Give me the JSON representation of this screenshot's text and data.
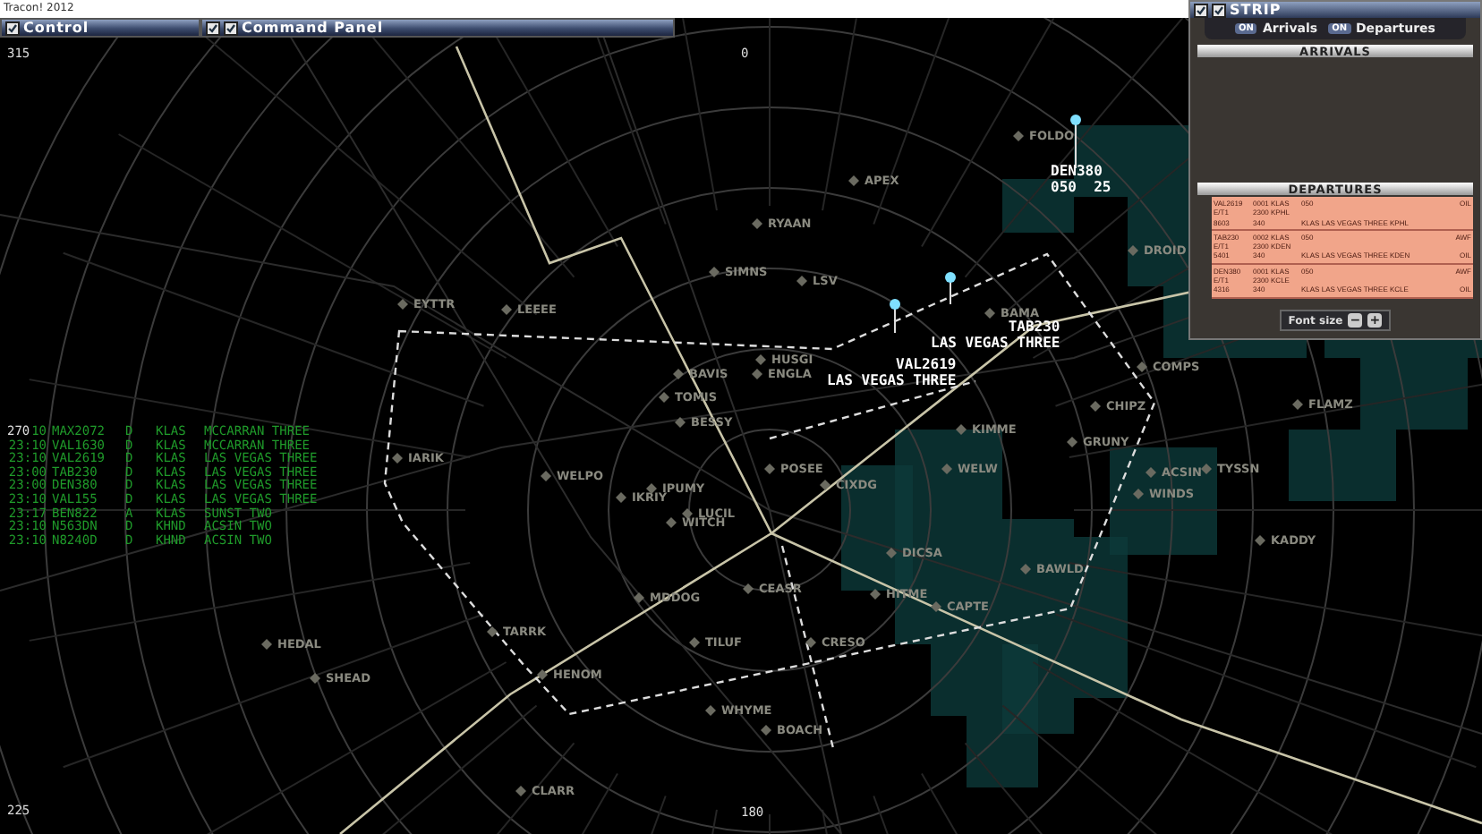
{
  "window": {
    "title": "Tracon! 2012"
  },
  "panels": [
    {
      "title": "Control",
      "checks": [
        {
          "checked": true
        }
      ]
    },
    {
      "title": "Command Panel",
      "checks": [
        {
          "checked": true
        },
        {
          "checked": true
        }
      ]
    }
  ],
  "radar": {
    "bearings": [
      "315",
      "0",
      "270",
      "225",
      "180"
    ],
    "fixes": [
      "FOLDO",
      "APEX",
      "RYAAN",
      "SIMNS",
      "LSV",
      "EYTTR",
      "LEEEE",
      "BAMA",
      "DROID",
      "HUSGI",
      "BAVIS",
      "ENGLA",
      "TOMIS",
      "BESSY",
      "IARIK",
      "WELPO",
      "IKRIY",
      "IPUMY",
      "POSEE",
      "LUCIL",
      "WITCH",
      "CIXDG",
      "KIMME",
      "WELW",
      "CHIPZ",
      "GRUNY",
      "COMPS",
      "FLAMZ",
      "ACSIN",
      "TYSSN",
      "WINDS",
      "KADDY",
      "BAWLD",
      "DICSA",
      "HITME",
      "CAPTE",
      "CEASR",
      "MDDOG",
      "TILUF",
      "CRESO",
      "TARRK",
      "HEDAL",
      "SHEAD",
      "HENOM",
      "WHYME",
      "BOACH",
      "CLARR"
    ],
    "aircraft": [
      {
        "lines": [
          "DEN380",
          "050  25"
        ]
      },
      {
        "lines": [
          "TAB230",
          "LAS VEGAS THREE"
        ]
      },
      {
        "lines": [
          "VAL2619",
          "LAS VEGAS THREE"
        ]
      }
    ]
  },
  "flight_list": {
    "rows": [
      {
        "time": "10",
        "callsign": "MAX2072",
        "type": "D",
        "airport": "KLAS",
        "route": "MCCARRAN THREE"
      },
      {
        "time": "23:10",
        "callsign": "VAL1630",
        "type": "D",
        "airport": "KLAS",
        "route": "MCCARRAN THREE"
      },
      {
        "time": "23:10",
        "callsign": "VAL2619",
        "type": "D",
        "airport": "KLAS",
        "route": "LAS VEGAS THREE"
      },
      {
        "time": "23:00",
        "callsign": "TAB230",
        "type": "D",
        "airport": "KLAS",
        "route": "LAS VEGAS THREE"
      },
      {
        "time": "23:00",
        "callsign": "DEN380",
        "type": "D",
        "airport": "KLAS",
        "route": "LAS VEGAS THREE"
      },
      {
        "time": "23:10",
        "callsign": "VAL155",
        "type": "D",
        "airport": "KLAS",
        "route": "LAS VEGAS THREE"
      },
      {
        "time": "23:17",
        "callsign": "BEN822",
        "type": "A",
        "airport": "KLAS",
        "route": "SUNST TWO"
      },
      {
        "time": "23:10",
        "callsign": "N563DN",
        "type": "D",
        "airport": "KHND",
        "route": "ACSIN TWO"
      },
      {
        "time": "23:10",
        "callsign": "N8240D",
        "type": "D",
        "airport": "KHND",
        "route": "ACSIN TWO"
      }
    ]
  },
  "strip": {
    "title": "STRIP",
    "checks": [
      {
        "checked": true
      },
      {
        "checked": true
      }
    ],
    "toggles": [
      {
        "state": "ON",
        "label": "Arrivals",
        "on": true
      },
      {
        "state": "ON",
        "label": "Departures",
        "on": true
      }
    ],
    "arrivals_header": "ARRIVALS",
    "departures_header": "DEPARTURES",
    "departures": [
      {
        "col1": [
          "VAL2619",
          "E/T1",
          "8603"
        ],
        "col2": [
          "0001 KLAS",
          "2300 KPHL",
          "340"
        ],
        "col3": [
          "050",
          "KLAS LAS VEGAS THREE KPHL"
        ],
        "col4": [
          "OIL"
        ]
      },
      {
        "col1": [
          "TAB230",
          "E/T1",
          "5401"
        ],
        "col2": [
          "0002 KLAS",
          "2300 KDEN",
          "340"
        ],
        "col3": [
          "050",
          "KLAS LAS VEGAS THREE KDEN"
        ],
        "col4": [
          "AWF",
          "OIL"
        ]
      },
      {
        "col1": [
          "DEN380",
          "E/T1",
          "4316"
        ],
        "col2": [
          "0001 KLAS",
          "2300 KCLE",
          "340"
        ],
        "col3": [
          "050",
          "KLAS LAS VEGAS THREE KCLE"
        ],
        "col4": [
          "AWF",
          "OIL"
        ]
      }
    ],
    "font_size": {
      "label": "Font size",
      "minus": "−",
      "plus": "+"
    }
  }
}
